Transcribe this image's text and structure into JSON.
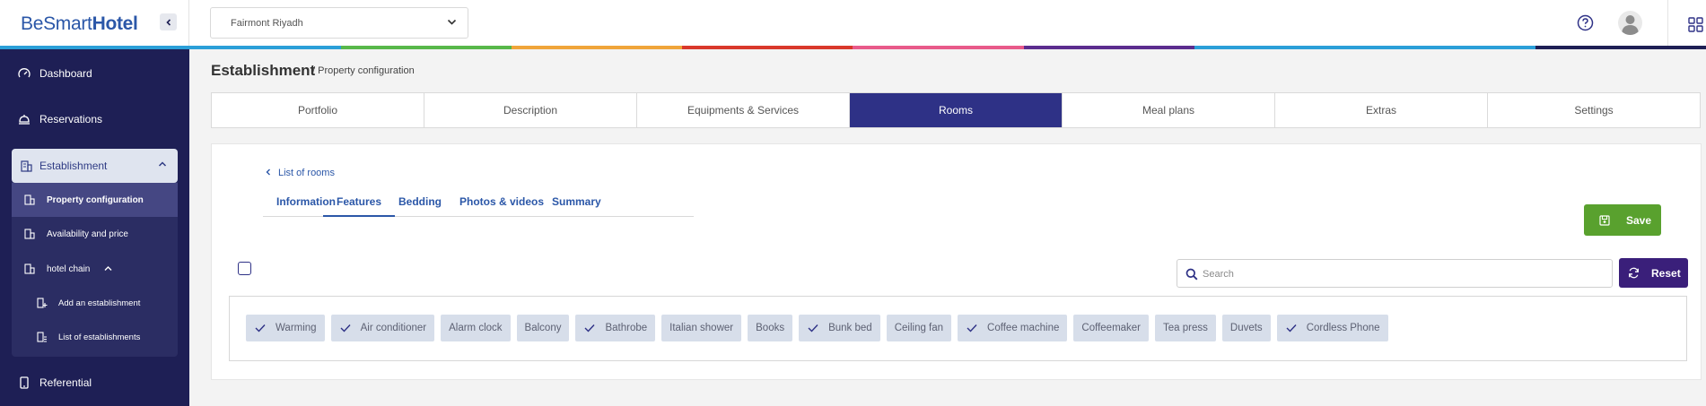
{
  "brand": {
    "name_part1": "BeSmart",
    "name_part2": "Hotel"
  },
  "header": {
    "selected_hotel": "Fairmont Riyadh"
  },
  "rainbow_colors": [
    "#2b9fd8",
    "#2b9fd8",
    "#58b84a",
    "#f0a53a",
    "#d9382b",
    "#e85a8a",
    "#5b2d8e",
    "#2b9fd8",
    "#2b9fd8",
    "#1e1f55"
  ],
  "sidebar": {
    "dashboard": "Dashboard",
    "reservations": "Reservations",
    "establishment": "Establishment",
    "property_configuration": "Property configuration",
    "availability_and_price": "Availability and price",
    "hotel_chain": "hotel chain",
    "add_establishment": "Add an establishment",
    "list_establishments": "List of establishments",
    "referential": "Referential"
  },
  "page": {
    "title": "Establishment",
    "breadcrumb": "/ Property configuration"
  },
  "tabs": [
    "Portfolio",
    "Description",
    "Equipments & Services",
    "Rooms",
    "Meal plans",
    "Extras",
    "Settings"
  ],
  "active_tab": "Rooms",
  "card": {
    "back_link": "List of rooms",
    "subtabs": [
      "Information",
      "Features",
      "Bedding",
      "Photos & videos",
      "Summary"
    ],
    "active_subtab": "Features",
    "save_label": "Save",
    "search_placeholder": "Search",
    "reset_label": "Reset"
  },
  "features": [
    {
      "label": "Warming",
      "checked": true
    },
    {
      "label": "Air conditioner",
      "checked": true
    },
    {
      "label": "Alarm clock",
      "checked": false
    },
    {
      "label": "Balcony",
      "checked": false
    },
    {
      "label": "Bathrobe",
      "checked": true
    },
    {
      "label": "Italian shower",
      "checked": false
    },
    {
      "label": "Books",
      "checked": false
    },
    {
      "label": "Bunk bed",
      "checked": true
    },
    {
      "label": "Ceiling fan",
      "checked": false
    },
    {
      "label": "Coffee machine",
      "checked": true
    },
    {
      "label": "Coffeemaker",
      "checked": false
    },
    {
      "label": "Tea press",
      "checked": false
    },
    {
      "label": "Duvets",
      "checked": false
    },
    {
      "label": "Cordless Phone",
      "checked": true
    }
  ]
}
